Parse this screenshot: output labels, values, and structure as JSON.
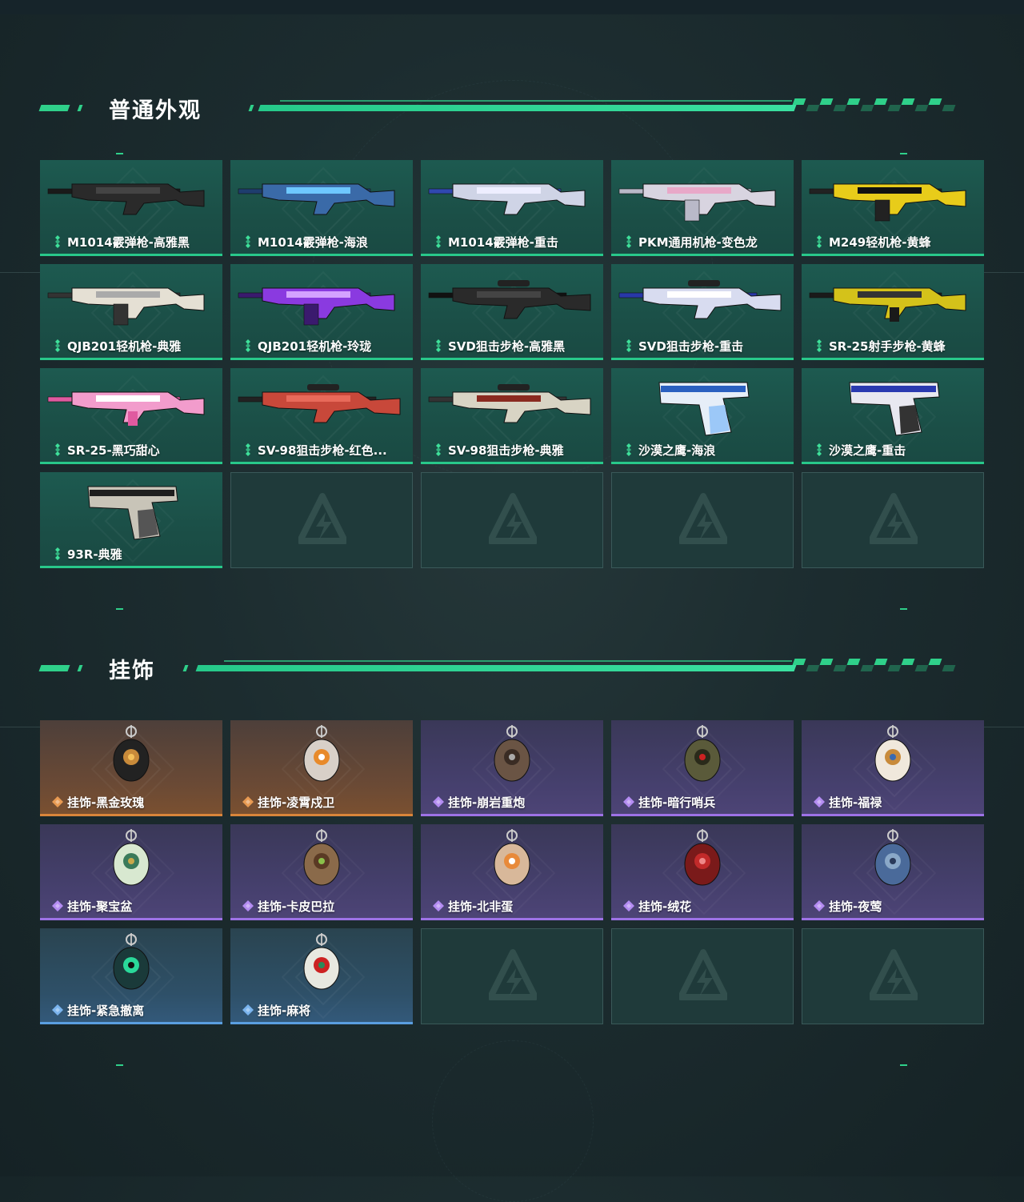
{
  "colors": {
    "accent_green": "#2fd08a",
    "rarity_green": "#28c88a",
    "rarity_orange": "#d9853a",
    "rarity_purple": "#9d72e6",
    "rarity_blue": "#5a9ee0"
  },
  "sections": [
    {
      "title": "普通外观",
      "items": [
        {
          "label": "M1014霰弹枪-高雅黑",
          "rarity": "green",
          "icon": "shotgun-icon"
        },
        {
          "label": "M1014霰弹枪-海浪",
          "rarity": "green",
          "icon": "shotgun-icon"
        },
        {
          "label": "M1014霰弹枪-重击",
          "rarity": "green",
          "icon": "shotgun-icon"
        },
        {
          "label": "PKM通用机枪-变色龙",
          "rarity": "green",
          "icon": "machine-gun-icon"
        },
        {
          "label": "M249轻机枪-黄蜂",
          "rarity": "green",
          "icon": "machine-gun-icon"
        },
        {
          "label": "QJB201轻机枪-典雅",
          "rarity": "green",
          "icon": "machine-gun-icon"
        },
        {
          "label": "QJB201轻机枪-玲珑",
          "rarity": "green",
          "icon": "machine-gun-icon"
        },
        {
          "label": "SVD狙击步枪-高雅黑",
          "rarity": "green",
          "icon": "sniper-rifle-icon"
        },
        {
          "label": "SVD狙击步枪-重击",
          "rarity": "green",
          "icon": "sniper-rifle-icon"
        },
        {
          "label": "SR-25射手步枪-黄蜂",
          "rarity": "green",
          "icon": "rifle-icon"
        },
        {
          "label": "SR-25-黑巧甜心",
          "rarity": "green",
          "icon": "rifle-icon"
        },
        {
          "label": "SV-98狙击步枪-红色...",
          "rarity": "green",
          "icon": "sniper-rifle-icon"
        },
        {
          "label": "SV-98狙击步枪-典雅",
          "rarity": "green",
          "icon": "sniper-rifle-icon"
        },
        {
          "label": "沙漠之鹰-海浪",
          "rarity": "green",
          "icon": "pistol-icon"
        },
        {
          "label": "沙漠之鹰-重击",
          "rarity": "green",
          "icon": "pistol-icon"
        },
        {
          "label": "93R-典雅",
          "rarity": "green",
          "icon": "pistol-icon"
        },
        {
          "label": "",
          "rarity": "empty",
          "icon": "logo-watermark-icon"
        },
        {
          "label": "",
          "rarity": "empty",
          "icon": "logo-watermark-icon"
        },
        {
          "label": "",
          "rarity": "empty",
          "icon": "logo-watermark-icon"
        },
        {
          "label": "",
          "rarity": "empty",
          "icon": "logo-watermark-icon"
        }
      ]
    },
    {
      "title": "挂饰",
      "items": [
        {
          "label": "挂饰-黑金玫瑰",
          "rarity": "orange",
          "icon": "charm-icon"
        },
        {
          "label": "挂饰-凌霄戍卫",
          "rarity": "orange",
          "icon": "charm-icon"
        },
        {
          "label": "挂饰-崩岩重炮",
          "rarity": "purple",
          "icon": "charm-icon"
        },
        {
          "label": "挂饰-暗行哨兵",
          "rarity": "purple",
          "icon": "charm-icon"
        },
        {
          "label": "挂饰-福禄",
          "rarity": "purple",
          "icon": "charm-icon"
        },
        {
          "label": "挂饰-聚宝盆",
          "rarity": "purple",
          "icon": "charm-icon"
        },
        {
          "label": "挂饰-卡皮巴拉",
          "rarity": "purple",
          "icon": "charm-icon"
        },
        {
          "label": "挂饰-北非蛋",
          "rarity": "purple",
          "icon": "charm-icon"
        },
        {
          "label": "挂饰-绒花",
          "rarity": "purple",
          "icon": "charm-icon"
        },
        {
          "label": "挂饰-夜莺",
          "rarity": "purple",
          "icon": "charm-icon"
        },
        {
          "label": "挂饰-紧急撤离",
          "rarity": "blue",
          "icon": "charm-icon"
        },
        {
          "label": "挂饰-麻将",
          "rarity": "blue",
          "icon": "charm-icon"
        },
        {
          "label": "",
          "rarity": "empty",
          "icon": "logo-watermark-icon"
        },
        {
          "label": "",
          "rarity": "empty",
          "icon": "logo-watermark-icon"
        },
        {
          "label": "",
          "rarity": "empty",
          "icon": "logo-watermark-icon"
        }
      ]
    }
  ]
}
